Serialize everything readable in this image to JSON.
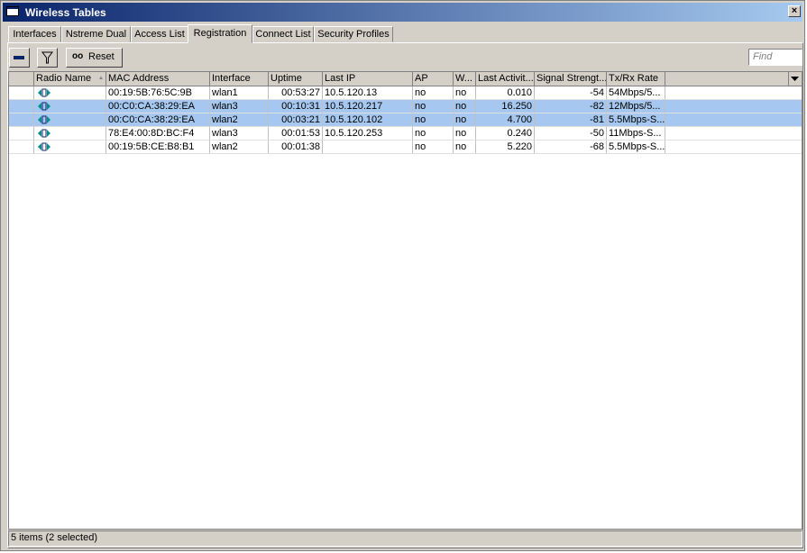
{
  "window": {
    "title": "Wireless Tables",
    "close_glyph": "×"
  },
  "tabs": [
    {
      "label": "Interfaces",
      "active": false
    },
    {
      "label": "Nstreme Dual",
      "active": false
    },
    {
      "label": "Access List",
      "active": false
    },
    {
      "label": "Registration",
      "active": true
    },
    {
      "label": "Connect List",
      "active": false
    },
    {
      "label": "Security Profiles",
      "active": false
    }
  ],
  "toolbar": {
    "remove_icon": "minus-icon",
    "filter_icon": "filter-icon",
    "reset_prefix": "oo",
    "reset_label": "Reset",
    "find_placeholder": "Find"
  },
  "table": {
    "columns": [
      "Radio Name",
      "MAC Address",
      "Interface",
      "Uptime",
      "Last IP",
      "AP",
      "W...",
      "Last Activit...",
      "Signal Strengt...",
      "Tx/Rx Rate"
    ],
    "sorted_column": "Radio Name",
    "rows": [
      {
        "selected": false,
        "icon": "wireless-client-icon",
        "radio_name": "",
        "mac": "00:19:5B:76:5C:9B",
        "interface": "wlan1",
        "uptime": "00:53:27",
        "last_ip": "10.5.120.13",
        "ap": "no",
        "w": "no",
        "last_activity": "0.010",
        "signal": "-54",
        "rate": "54Mbps/5..."
      },
      {
        "selected": true,
        "icon": "wireless-client-icon",
        "radio_name": "",
        "mac": "00:C0:CA:38:29:EA",
        "interface": "wlan3",
        "uptime": "00:10:31",
        "last_ip": "10.5.120.217",
        "ap": "no",
        "w": "no",
        "last_activity": "16.250",
        "signal": "-82",
        "rate": "12Mbps/5..."
      },
      {
        "selected": true,
        "icon": "wireless-client-icon",
        "radio_name": "",
        "mac": "00:C0:CA:38:29:EA",
        "interface": "wlan2",
        "uptime": "00:03:21",
        "last_ip": "10.5.120.102",
        "ap": "no",
        "w": "no",
        "last_activity": "4.700",
        "signal": "-81",
        "rate": "5.5Mbps-S..."
      },
      {
        "selected": false,
        "icon": "wireless-client-icon",
        "radio_name": "",
        "mac": "78:E4:00:8D:BC:F4",
        "interface": "wlan3",
        "uptime": "00:01:53",
        "last_ip": "10.5.120.253",
        "ap": "no",
        "w": "no",
        "last_activity": "0.240",
        "signal": "-50",
        "rate": "11Mbps-S..."
      },
      {
        "selected": false,
        "icon": "wireless-client-icon",
        "radio_name": "",
        "mac": "00:19:5B:CE:B8:B1",
        "interface": "wlan2",
        "uptime": "00:01:38",
        "last_ip": "",
        "ap": "no",
        "w": "no",
        "last_activity": "5.220",
        "signal": "-68",
        "rate": "5.5Mbps-S..."
      }
    ]
  },
  "status": {
    "text": "5 items (2 selected)"
  },
  "colors": {
    "selection": "#a6c8f0",
    "titlebar_start": "#0a246a",
    "titlebar_end": "#a6caf0",
    "face": "#d4d0c8"
  }
}
